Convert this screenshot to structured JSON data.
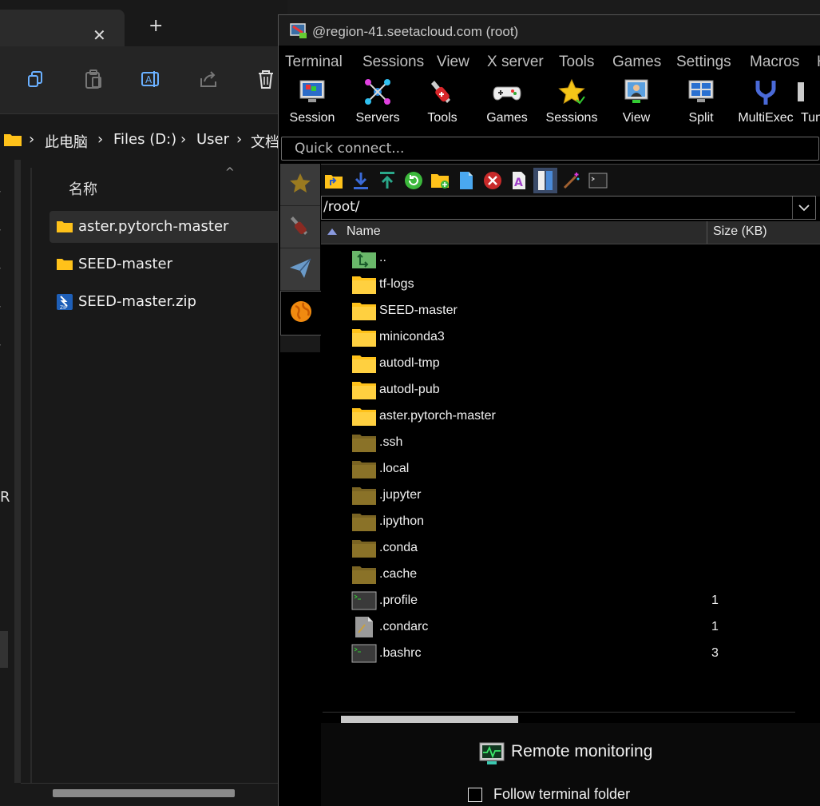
{
  "explorer": {
    "tab_close": "✕",
    "new_tab": "+",
    "breadcrumb": [
      "此电脑",
      "Files (D:)",
      "User",
      "文档"
    ],
    "breadcrumb_sep": "›",
    "column_name": "名称",
    "files": [
      {
        "name": "aster.pytorch-master",
        "type": "folder",
        "selected": true
      },
      {
        "name": "SEED-master",
        "type": "folder",
        "selected": false
      },
      {
        "name": "SEED-master.zip",
        "type": "zip",
        "selected": false
      }
    ],
    "side_letter": "R"
  },
  "moba": {
    "title": "@region-41.seetacloud.com (root)",
    "menu": [
      "Terminal",
      "Sessions",
      "View",
      "X server",
      "Tools",
      "Games",
      "Settings",
      "Macros",
      "H"
    ],
    "toolbar": [
      {
        "label": "Session",
        "icon": "monitor-icon"
      },
      {
        "label": "Servers",
        "icon": "servers-icon"
      },
      {
        "label": "Tools",
        "icon": "swiss-knife-icon"
      },
      {
        "label": "Games",
        "icon": "gamepad-icon"
      },
      {
        "label": "Sessions",
        "icon": "star-icon"
      },
      {
        "label": "View",
        "icon": "view-icon"
      },
      {
        "label": "Split",
        "icon": "split-icon"
      },
      {
        "label": "MultiExec",
        "icon": "fork-icon"
      },
      {
        "label": "Tunn",
        "icon": "tunnel-icon"
      }
    ],
    "quick_connect_placeholder": "Quick connect...",
    "sftp": {
      "path": "/root/",
      "col_name": "Name",
      "col_size": "Size (KB)",
      "files": [
        {
          "name": "..",
          "kind": "up",
          "size": ""
        },
        {
          "name": "tf-logs",
          "kind": "folder",
          "size": ""
        },
        {
          "name": "SEED-master",
          "kind": "folder",
          "size": ""
        },
        {
          "name": "miniconda3",
          "kind": "folder",
          "size": ""
        },
        {
          "name": "autodl-tmp",
          "kind": "folder",
          "size": ""
        },
        {
          "name": "autodl-pub",
          "kind": "folder",
          "size": ""
        },
        {
          "name": "aster.pytorch-master",
          "kind": "folder",
          "size": ""
        },
        {
          "name": ".ssh",
          "kind": "hidden-folder",
          "size": ""
        },
        {
          "name": ".local",
          "kind": "hidden-folder",
          "size": ""
        },
        {
          "name": ".jupyter",
          "kind": "hidden-folder",
          "size": ""
        },
        {
          "name": ".ipython",
          "kind": "hidden-folder",
          "size": ""
        },
        {
          "name": ".conda",
          "kind": "hidden-folder",
          "size": ""
        },
        {
          "name": ".cache",
          "kind": "hidden-folder",
          "size": ""
        },
        {
          "name": ".profile",
          "kind": "shell-file",
          "size": "1"
        },
        {
          "name": ".condarc",
          "kind": "text-file",
          "size": "1"
        },
        {
          "name": ".bashrc",
          "kind": "shell-file",
          "size": "3"
        }
      ],
      "remote_monitoring": "Remote monitoring",
      "follow_terminal_folder": "Follow terminal folder",
      "follow_checked": false
    }
  },
  "colors": {
    "folder": "#ffc21a",
    "hidden_folder": "#7a6423",
    "accent": "#8a9adf"
  }
}
